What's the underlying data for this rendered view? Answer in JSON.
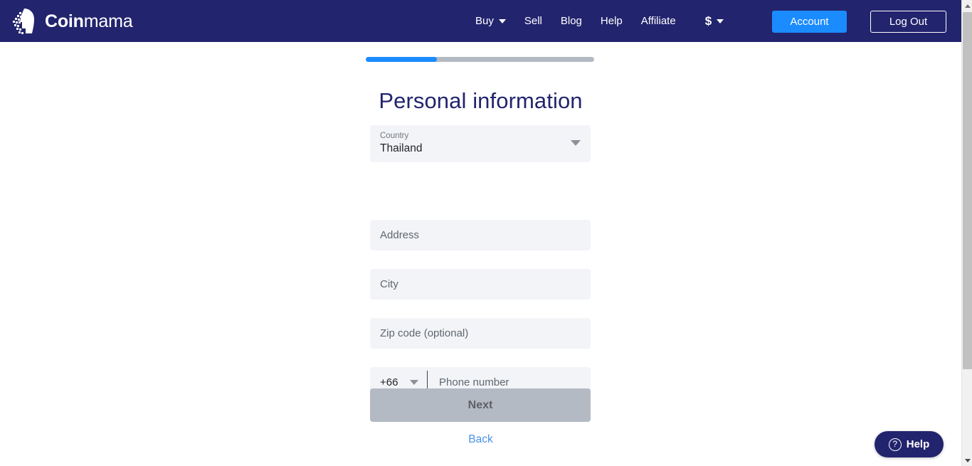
{
  "header": {
    "brand": {
      "name_bold": "Coin",
      "name_light": "mama",
      "logo_icon": "pixelated-face-logo"
    },
    "nav": [
      {
        "label": "Buy",
        "has_dropdown": true
      },
      {
        "label": "Sell",
        "has_dropdown": false
      },
      {
        "label": "Blog",
        "has_dropdown": false
      },
      {
        "label": "Help",
        "has_dropdown": false
      },
      {
        "label": "Affiliate",
        "has_dropdown": false
      },
      {
        "label": "$",
        "has_dropdown": true
      }
    ],
    "account_button": "Account",
    "logout_button": "Log Out",
    "colors": {
      "bar": "#23246e",
      "accent": "#1a8cff"
    }
  },
  "main": {
    "progress_percent": 31,
    "title": "Personal information",
    "country_field": {
      "label": "Country",
      "value": "Thailand"
    },
    "address_placeholder": "Address",
    "city_placeholder": "City",
    "zip_placeholder": "Zip code (optional)",
    "phone": {
      "country_code": "+66",
      "placeholder": "Phone number"
    },
    "next_button": "Next",
    "back_link": "Back"
  },
  "help_widget": {
    "label": "Help",
    "icon": "question-circle-icon"
  }
}
